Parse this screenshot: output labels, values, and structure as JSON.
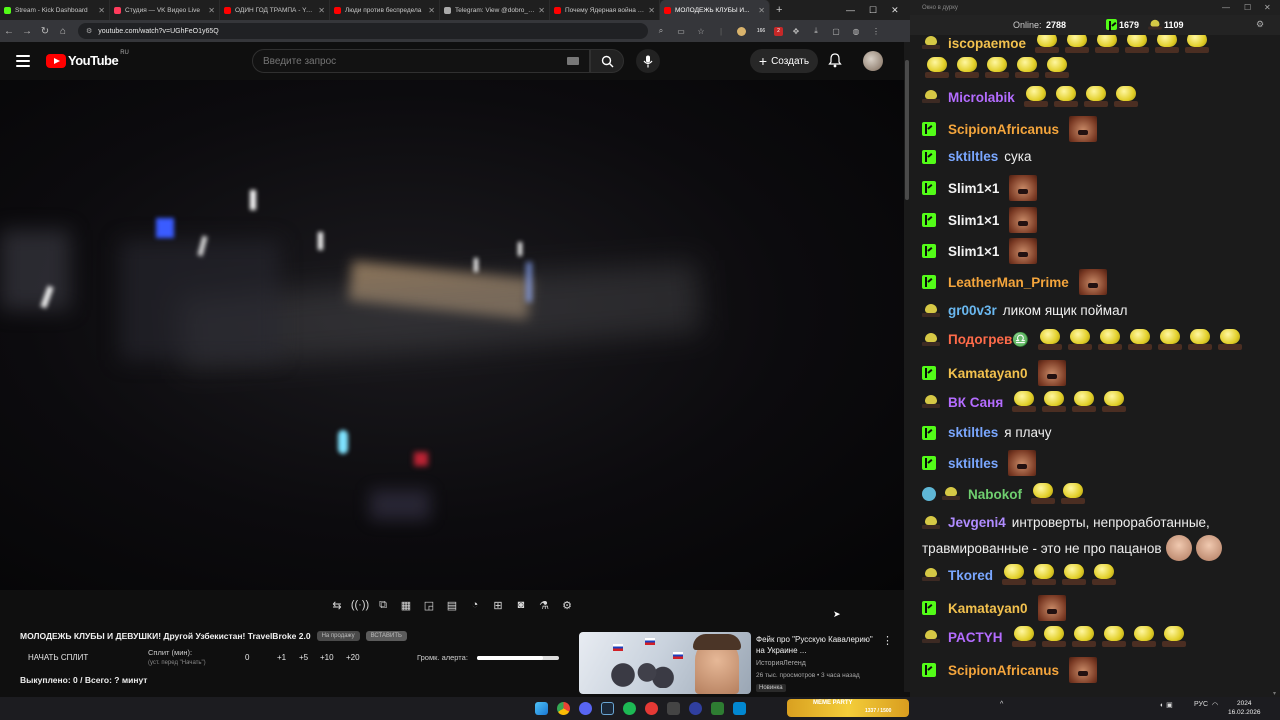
{
  "browser": {
    "tabs": [
      {
        "title": "Stream - Kick Dashboard",
        "color": "#53fc18"
      },
      {
        "title": "Студия — VK Видео Live",
        "color": "#ff3b5c"
      },
      {
        "title": "ОДИН ГОД ТРАМПА - YouTube",
        "color": "#ff0000"
      },
      {
        "title": "Люди против беспредела",
        "color": "#ff0000"
      },
      {
        "title": "Telegram: View @dobro_2ch",
        "color": "#aaaaaa"
      },
      {
        "title": "Почему Ядерная война уже...",
        "color": "#ff0000"
      },
      {
        "title": "МОЛОДЕЖЬ КЛУБЫ И...",
        "color": "#ff0000"
      }
    ],
    "url": "youtube.com/watch?v=UGhFeO1y65Q",
    "ext_count_1": "166",
    "ext_count_2": "2"
  },
  "youtube": {
    "logo_text": "YouTube",
    "region": "RU",
    "search_placeholder": "Введите запрос",
    "create_label": "Создать"
  },
  "below": {
    "video_title": "МОЛОДЕЖЬ КЛУБЫ И ДЕВУШКИ! Другой Узбекистан! TravelBroke 2.0",
    "pill_1": "На продажу",
    "pill_2": "ВСТАВИТЬ",
    "split_button": "НАЧАТЬ СПЛИТ",
    "split_label": "Сплит (мин):",
    "split_hint": "(уст. перед \"Начать\")",
    "split_values": [
      "0",
      "+1",
      "+5",
      "+10",
      "+20"
    ],
    "alert_volume_label": "Громк. алерта:",
    "alert_volume": 0.8,
    "bought": "Выкуплено: 0 / Всего: ? минут"
  },
  "recommended": {
    "title": "Фейк про \"Русскую Кавалерию\" на Украине ...",
    "channel": "ИсторияЛегенд",
    "meta": "26 тыс. просмотров • 3 часа назад",
    "badge": "Новинка"
  },
  "chat": {
    "window_title": "Окно в дурку",
    "online_label": "Online:",
    "online": "2788",
    "kick_count": "1679",
    "other_count": "1109",
    "messages": [
      {
        "user": "iscopaemoe",
        "color": "#f2c14e",
        "badge": "e",
        "text": ""
      },
      {
        "user": "Microlabik",
        "color": "#b46cff",
        "badge": "e",
        "text": ""
      },
      {
        "user": "ScipionAfricanus",
        "color": "#f4a53c",
        "badge": "k",
        "text": ""
      },
      {
        "user": "sktiltles",
        "color": "#7aa7ff",
        "badge": "k",
        "text": "сука"
      },
      {
        "user": "Slim1×1",
        "color": "#f2f2f2",
        "badge": "k",
        "text": ""
      },
      {
        "user": "Slim1×1",
        "color": "#f2f2f2",
        "badge": "k",
        "text": ""
      },
      {
        "user": "Slim1×1",
        "color": "#f2f2f2",
        "badge": "k",
        "text": ""
      },
      {
        "user": "LeatherMan_Prime",
        "color": "#f4a53c",
        "badge": "k",
        "text": ""
      },
      {
        "user": "gr00v3r",
        "color": "#6ab8f0",
        "badge": "e",
        "text": "ликом ящик поймал"
      },
      {
        "user": "Подогрев♎",
        "color": "#ff6b4a",
        "badge": "e",
        "text": ""
      },
      {
        "user": "Kamatayan0",
        "color": "#f2c14e",
        "badge": "k",
        "text": ""
      },
      {
        "user": "ВК Саня",
        "color": "#b46cff",
        "badge": "e",
        "text": ""
      },
      {
        "user": "sktiltles",
        "color": "#7aa7ff",
        "badge": "k",
        "text": "я плачу"
      },
      {
        "user": "sktiltles",
        "color": "#7aa7ff",
        "badge": "k",
        "text": ""
      },
      {
        "user": "Nabokof",
        "color": "#6fcf6f",
        "badge": "v",
        "text": ""
      },
      {
        "user": "Jevgeni4",
        "color": "#b08cff",
        "badge": "e",
        "text": "интроверты, непроработанные,"
      },
      {
        "user": "",
        "color": "#efefef",
        "badge": "",
        "text": "травмированные - это не про пацанов"
      },
      {
        "user": "Tkored",
        "color": "#7aa7ff",
        "badge": "e",
        "text": ""
      },
      {
        "user": "Kamatayan0",
        "color": "#f2c14e",
        "badge": "k",
        "text": ""
      },
      {
        "user": "PACTYH",
        "color": "#b46cff",
        "badge": "e",
        "text": ""
      },
      {
        "user": "ScipionAfricanus",
        "color": "#f4a53c",
        "badge": "k",
        "text": ""
      }
    ]
  },
  "taskbar": {
    "meme_label": "MEME PARTY",
    "meme_sub": "1337 / 1500",
    "lang": "РУС",
    "time": "2024",
    "date": "16.02.2026"
  }
}
